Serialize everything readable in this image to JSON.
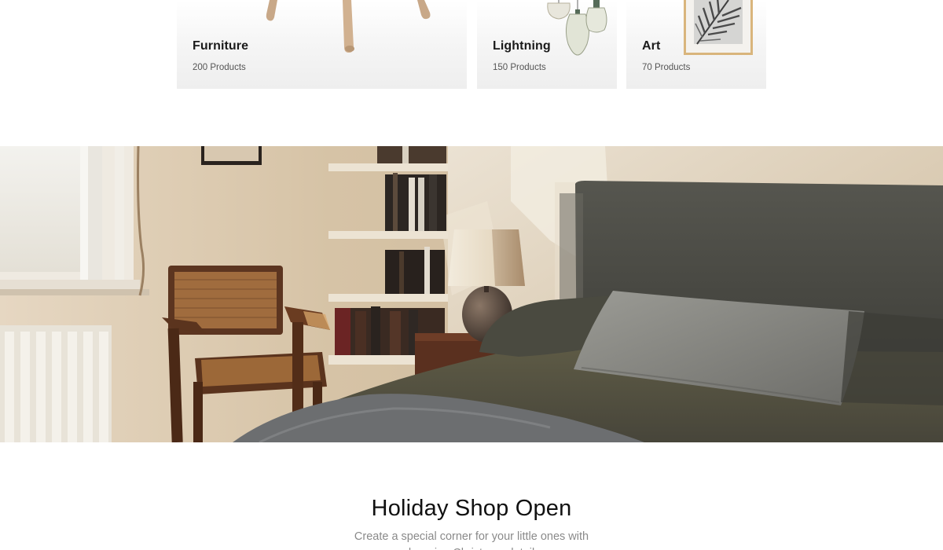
{
  "categories": [
    {
      "title": "Furniture",
      "count": "200 Products",
      "illustration": "stool-legs-image"
    },
    {
      "title": "Lightning",
      "count": "150 Products",
      "illustration": "pendant-lamps-image"
    },
    {
      "title": "Art",
      "count": "70 Products",
      "illustration": "framed-art-image"
    }
  ],
  "hero": {
    "image": "bedroom-interior-image"
  },
  "holiday": {
    "title": "Holiday Shop Open",
    "subtitle": "Create a special corner for your little ones with charming Christmas details"
  },
  "colors": {
    "card_bg": "#f1f1f1",
    "title_text": "#111111",
    "subtitle_text": "#8a8a8a",
    "wall": "#d8c7ad",
    "headboard": "#4a4a47",
    "bedding": "#5a5641"
  }
}
